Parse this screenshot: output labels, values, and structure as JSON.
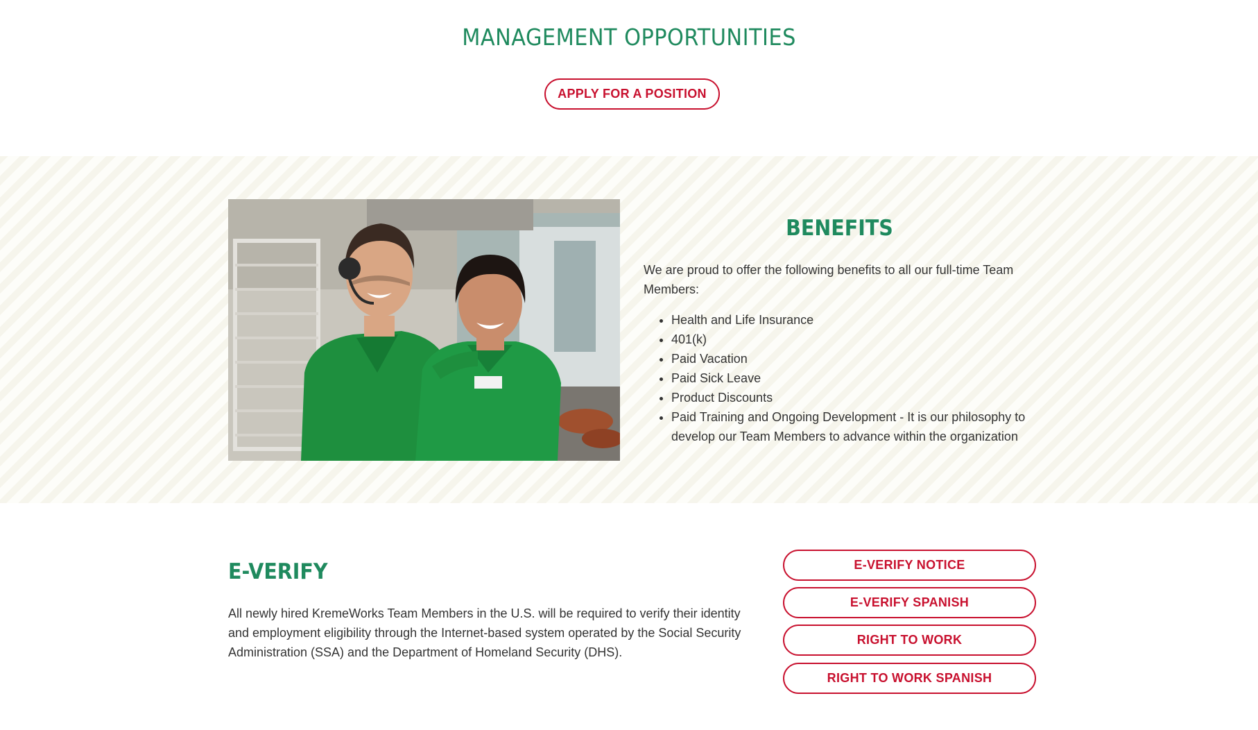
{
  "management": {
    "title": "MANAGEMENT OPPORTUNITIES",
    "apply_button": "APPLY FOR A POSITION"
  },
  "benefits": {
    "title": "BENEFITS",
    "intro": "We are proud to offer the following benefits to all our full-time Team Members:",
    "items": [
      "Health and Life Insurance",
      "401(k)",
      "Paid Vacation",
      "Paid Sick Leave",
      "Product Discounts",
      "Paid Training and Ongoing Development - It is our philosophy to develop our Team Members to advance within the organization"
    ]
  },
  "everify": {
    "title": "E-VERIFY",
    "text": "All newly hired KremeWorks Team Members in the U.S. will be required to verify their identity and employment eligibility through the Internet-based system operated by the Social Security Administration (SSA) and the Department of Homeland Security (DHS).",
    "buttons": [
      "E-VERIFY NOTICE",
      "E-VERIFY SPANISH",
      "RIGHT TO WORK",
      "RIGHT TO WORK SPANISH"
    ]
  },
  "colors": {
    "brand_green": "#1f8a5e",
    "brand_red": "#c8102e",
    "text": "#333333"
  }
}
